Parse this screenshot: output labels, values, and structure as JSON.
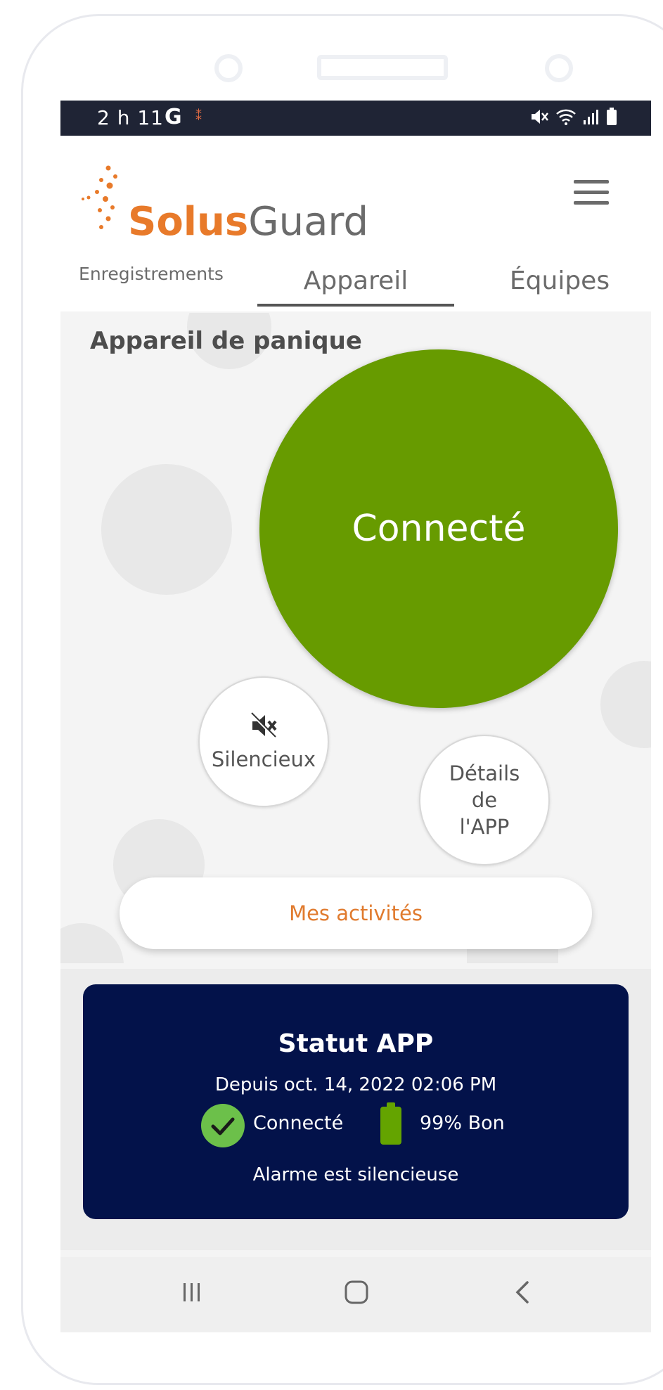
{
  "status_bar": {
    "time": "2 h 11",
    "g_label": "G"
  },
  "header": {
    "brand_primary": "Solus",
    "brand_secondary": "Guard",
    "colors": {
      "brand_orange": "#e87a2a",
      "brand_gray": "#6b6b6b"
    }
  },
  "tabs": [
    {
      "label": "Enregistrements",
      "active": false
    },
    {
      "label": "Appareil",
      "active": true
    },
    {
      "label": "Équipes",
      "active": false
    }
  ],
  "device": {
    "title": "Appareil de panique",
    "status_label": "Connecté",
    "status_color": "#679b00",
    "silent_label": "Silencieux",
    "details_lines": [
      "Détails",
      "de",
      "l'APP"
    ],
    "activities_label": "Mes activités"
  },
  "status_card": {
    "title": "Statut APP",
    "since": "Depuis oct. 14, 2022 02:06 PM",
    "connection": "Connecté",
    "battery": "99% Bon",
    "battery_level": 0.99,
    "alarm": "Alarme est silencieuse",
    "background_color": "#03124a"
  },
  "icons": {
    "status_bar": [
      "mute-icon",
      "wifi-icon",
      "signal-icon",
      "battery-icon"
    ],
    "silent": "speaker-mute-icon",
    "nav": [
      "recent-apps-icon",
      "home-icon",
      "back-icon"
    ]
  }
}
